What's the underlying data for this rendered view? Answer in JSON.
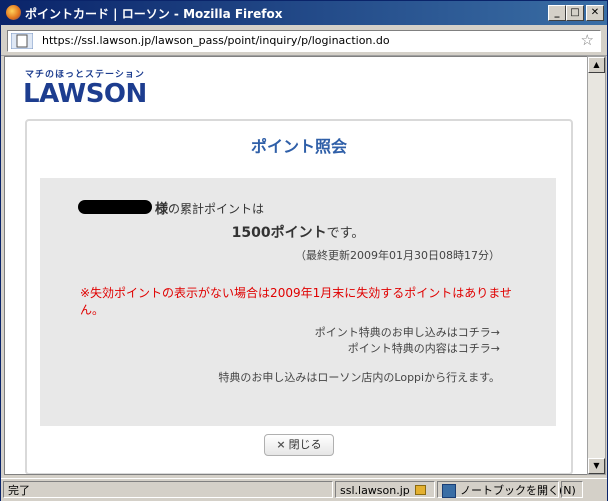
{
  "window": {
    "title": "ポイントカード | ローソン - Mozilla Firefox",
    "minimize": "_",
    "maximize": "□",
    "close": "✕"
  },
  "address_bar": {
    "url": "https://ssl.lawson.jp/lawson_pass/point/inquiry/p/loginaction.do",
    "bookmark_star": "☆"
  },
  "logo": {
    "tagline": "マチのほっとステーション",
    "brand": "LAWSON"
  },
  "panel": {
    "title": "ポイント照会",
    "name_suffix": "様",
    "cumulative_text": "の累計ポイントは",
    "points_value": "1500ポイント",
    "points_suffix": "です。",
    "last_updated": "（最終更新2009年01月30日08時17分）",
    "warning": "※失効ポイントの表示がない場合は2009年1月末に失効するポイントはありません。",
    "link_apply": "ポイント特典のお申し込みはコチラ→",
    "link_contents": "ポイント特典の内容はコチラ→",
    "note": "特典のお申し込みはローソン店内のLoppiから行えます。",
    "close_icon": "×",
    "close_label": "閉じる"
  },
  "status_bar": {
    "status": "完了",
    "domain": "ssl.lawson.jp",
    "notebook": "ノートブックを開く(N)"
  }
}
